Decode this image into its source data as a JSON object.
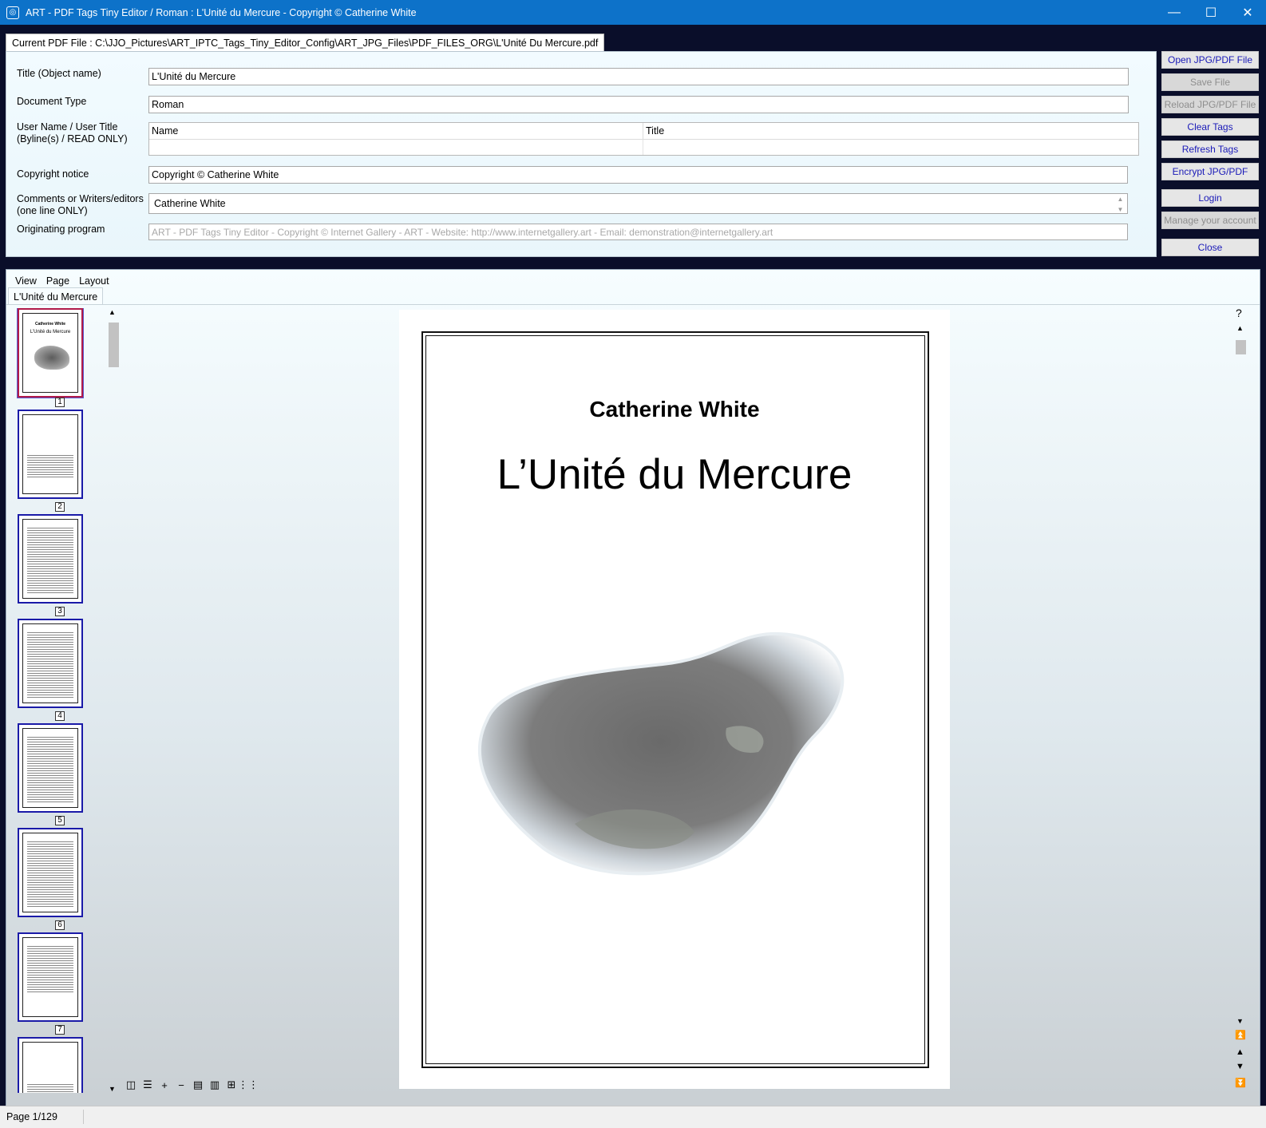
{
  "window": {
    "title": "ART - PDF Tags Tiny Editor  / Roman : L'Unité du Mercure - Copyright © Catherine White",
    "minimize": "—",
    "maximize": "☐",
    "close": "✕"
  },
  "current_file": "Current PDF File : C:\\JJO_Pictures\\ART_IPTC_Tags_Tiny_Editor_Config\\ART_JPG_Files\\PDF_FILES_ORG\\L'Unité Du Mercure.pdf",
  "form": {
    "title_label": "Title (Object name)",
    "title_value": "L'Unité du Mercure",
    "doctype_label": "Document Type",
    "doctype_value": "Roman",
    "user_label_1": "User Name / User Title",
    "user_label_2": "(Byline(s) / READ ONLY)",
    "user_col_name": "Name",
    "user_col_title": "Title",
    "copyright_label": "Copyright notice",
    "copyright_value": "Copyright © Catherine White",
    "comments_label_1": "Comments or Writers/editors",
    "comments_label_2": "(one line ONLY)",
    "comments_value": "Catherine White",
    "program_label": "Originating program",
    "program_value": "ART - PDF Tags Tiny Editor - Copyright © Internet Gallery - ART - Website: http://www.internetgallery.art - Email: demonstration@internetgallery.art"
  },
  "buttons": {
    "open": "Open JPG/PDF File",
    "save": "Save File",
    "reload": "Reload JPG/PDF File",
    "clear": "Clear Tags",
    "refresh": "Refresh Tags",
    "encrypt": "Encrypt JPG/PDF",
    "login": "Login",
    "manage": "Manage your account",
    "close": "Close"
  },
  "viewer": {
    "menu": [
      "View",
      "Page",
      "Layout"
    ],
    "doc_tab": "L'Unité du Mercure",
    "thumbnails": [
      "1",
      "2",
      "3",
      "4",
      "5",
      "6",
      "7"
    ],
    "page_author": "Catherine White",
    "page_title": "L’Unité du Mercure",
    "help": "?"
  },
  "status": {
    "page": "Page 1/129"
  }
}
